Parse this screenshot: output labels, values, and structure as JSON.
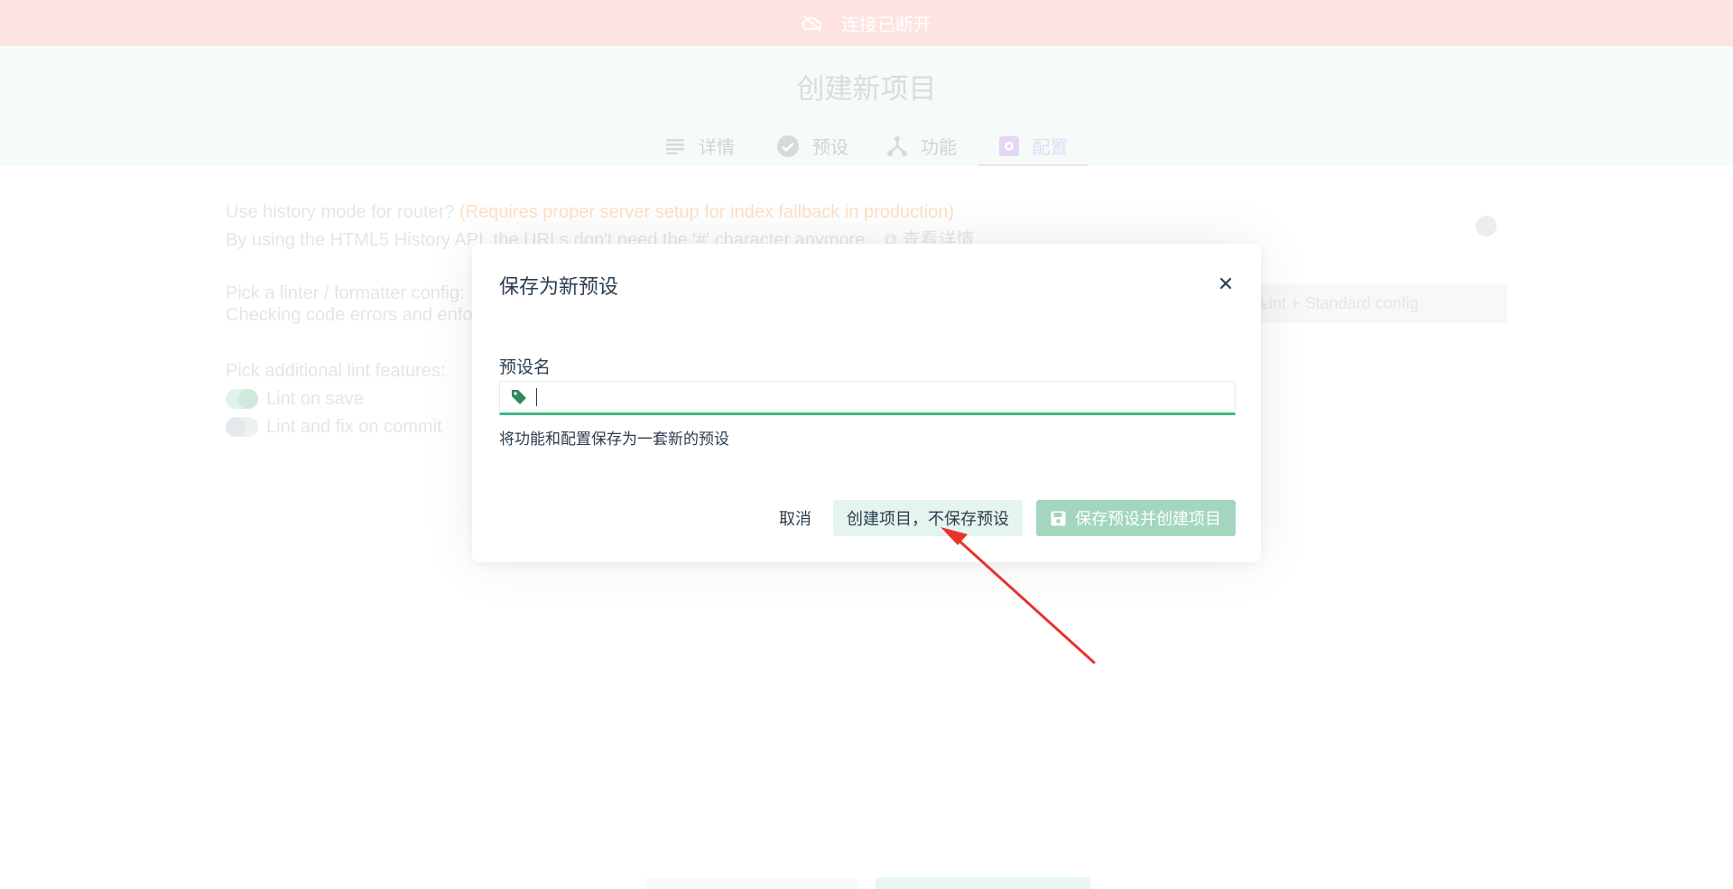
{
  "banner": {
    "icon": "cloud-off-icon",
    "text": "连接已断开",
    "color": "#fde4e1"
  },
  "header": {
    "title": "创建新项目",
    "steps": [
      {
        "label": "详情",
        "icon": "list-icon"
      },
      {
        "label": "预设",
        "icon": "check-circle-icon"
      },
      {
        "label": "功能",
        "icon": "fork-icon"
      },
      {
        "label": "配置",
        "icon": "settings-icon",
        "active": true
      }
    ]
  },
  "background": {
    "history_mode": {
      "title": "Use history mode for router?",
      "warning": "(Requires proper server setup for index fallback in production)",
      "desc": "By using the HTML5 History API, the URLs don't need the '#' character anymore.",
      "link": "查看详情"
    },
    "linter": {
      "title": "Pick a linter / formatter config:",
      "desc": "Checking code errors and enfo",
      "selected": "Lint + Standard config"
    },
    "lint_features": {
      "title": "Pick additional lint features:",
      "options": [
        {
          "label": "Lint on save",
          "checked": true
        },
        {
          "label": "Lint and fix on commit",
          "checked": false
        }
      ]
    }
  },
  "modal": {
    "title": "保存为新预设",
    "field_label": "预设名",
    "input_value": "",
    "input_placeholder": "",
    "help_text": "将功能和配置保存为一套新的预设",
    "cancel_label": "取消",
    "create_no_save_label": "创建项目，不保存预设",
    "save_and_create_label": "保存预设并创建项目"
  },
  "colors": {
    "accent": "#42b983",
    "primary_button": "#a4d6bf",
    "annotation_arrow": "#e8332b"
  }
}
